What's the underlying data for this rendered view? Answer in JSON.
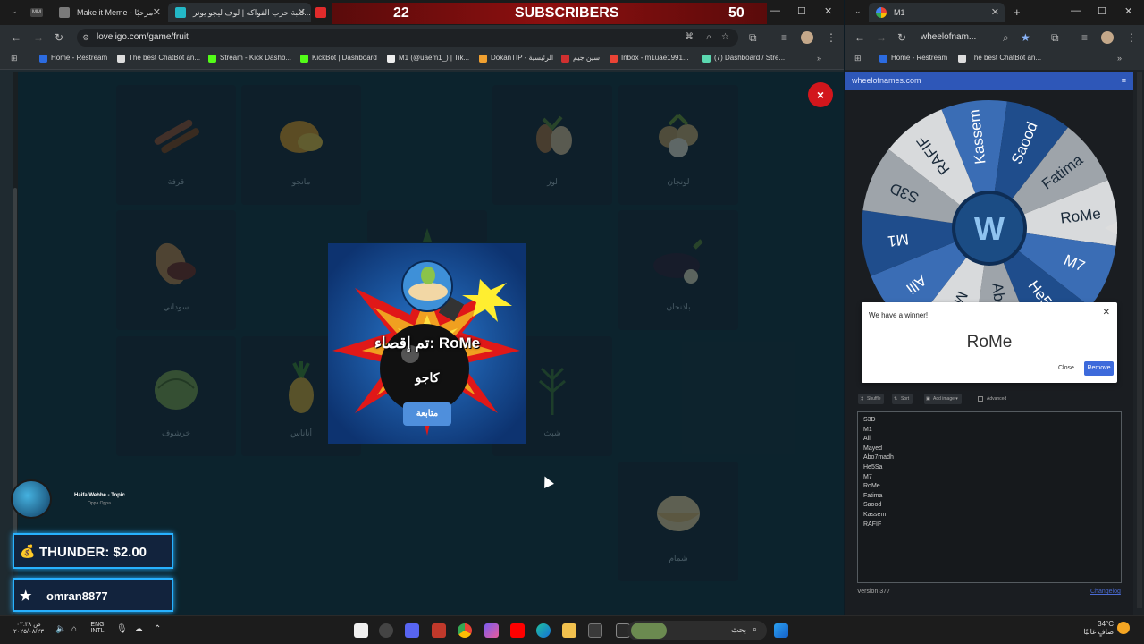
{
  "left_browser": {
    "tabs": [
      {
        "title": "Make it Meme - مرحبًا",
        "favicon_color": "#7a7a7a"
      },
      {
        "title": "لعبة حرب الفواكه | لوف ليجو يونر...",
        "favicon_color": "#23b8c7"
      },
      {
        "title": "",
        "favicon_color": "#e02b2b"
      }
    ],
    "subscriber_banner": {
      "left_count": "22",
      "label": "SUBSCRIBERS",
      "right_count": "50"
    },
    "url": "loveligo.com/game/fruit",
    "bookmarks": [
      {
        "label": "Home - Restream",
        "color": "#2c6be0"
      },
      {
        "label": "The best ChatBot an...",
        "color": "#dddddd"
      },
      {
        "label": "Stream - Kick Dashb...",
        "color": "#53fc18"
      },
      {
        "label": "KickBot | Dashboard",
        "color": "#53fc18"
      },
      {
        "label": "M1 (@uaem1_) | Tik...",
        "color": "#eeeeee"
      },
      {
        "label": "DokanTIP - الرئيسية",
        "color": "#f0a030"
      },
      {
        "label": "سين جيم",
        "color": "#d03030"
      },
      {
        "label": "Inbox - m1uae1991...",
        "color": "#ea4335"
      },
      {
        "label": "(7) Dashboard / Stre...",
        "color": "#5bd8b0"
      }
    ]
  },
  "game": {
    "cards": [
      {
        "label": "قرفة",
        "icon": "cinnamon-icon"
      },
      {
        "label": "مانجو",
        "icon": "mango-icon"
      },
      {
        "label": "لوز",
        "icon": "almond-icon"
      },
      {
        "label": "لونجان",
        "icon": "longan-icon"
      },
      {
        "label": "سوداني",
        "icon": "peanut-icon"
      },
      {
        "label": "باذنجان",
        "icon": "eggplant-icon"
      },
      {
        "label": "خرشوف",
        "icon": "artichoke-icon"
      },
      {
        "label": "أناناس",
        "icon": "pineapple-icon"
      },
      {
        "label": "شبث",
        "icon": "dill-icon"
      },
      {
        "label": "شمام",
        "icon": "melon-icon"
      }
    ],
    "popup": {
      "eliminated_text": "تم إقصاء: RoMe",
      "fruit_name": "كاجو",
      "continue_label": "متابعة"
    },
    "close_label": "×"
  },
  "stream_overlay": {
    "music_title": "Haifa Wehbe - Topic",
    "music_subtitle": "Oppa Oppa",
    "donation": "THUNDER: $2.00",
    "follower": "omran8877"
  },
  "right_browser": {
    "tab_title": "M1",
    "url": "wheelofnam...",
    "bookmarks": [
      {
        "label": "Home - Restream",
        "color": "#2c6be0"
      },
      {
        "label": "The best ChatBot an...",
        "color": "#dddddd"
      }
    ],
    "site_header": "wheelofnames.com",
    "wheel": {
      "names": [
        "Kassem",
        "Saood",
        "Fatima",
        "RoMe",
        "M7",
        "He5Sa",
        "Abo7madh",
        "Mayed",
        "Alli",
        "M1",
        "S3D",
        "RAFIF"
      ],
      "colors": [
        "#3a6db5",
        "#1f4d8c",
        "#9ea4aa",
        "#d8dadc"
      ]
    },
    "winner_dialog": {
      "title": "We have a winner!",
      "name": "RoMe",
      "close_label": "Close",
      "remove_label": "Remove"
    },
    "toolbar": [
      "Shuffle",
      "Sort",
      "Add image",
      "Advanced"
    ],
    "entries": [
      "S3D",
      "M1",
      "Alli",
      "Mayed",
      "Abo7madh",
      "He5Sa",
      "M7",
      "RoMe",
      "Fatima",
      "Saood",
      "Kassem",
      "RAFIF"
    ],
    "version": "Version 377",
    "changelog": "Changelog"
  },
  "taskbar": {
    "clock_time": "۰۳:۳۸ ص",
    "clock_date": "۲۰۲۵/۰۸/۲۳",
    "lang": "ENG",
    "lang_sub": "INTL",
    "search_placeholder": "بحث",
    "weather_temp": "34°C",
    "weather_desc": "صافٍ غالبًا"
  }
}
